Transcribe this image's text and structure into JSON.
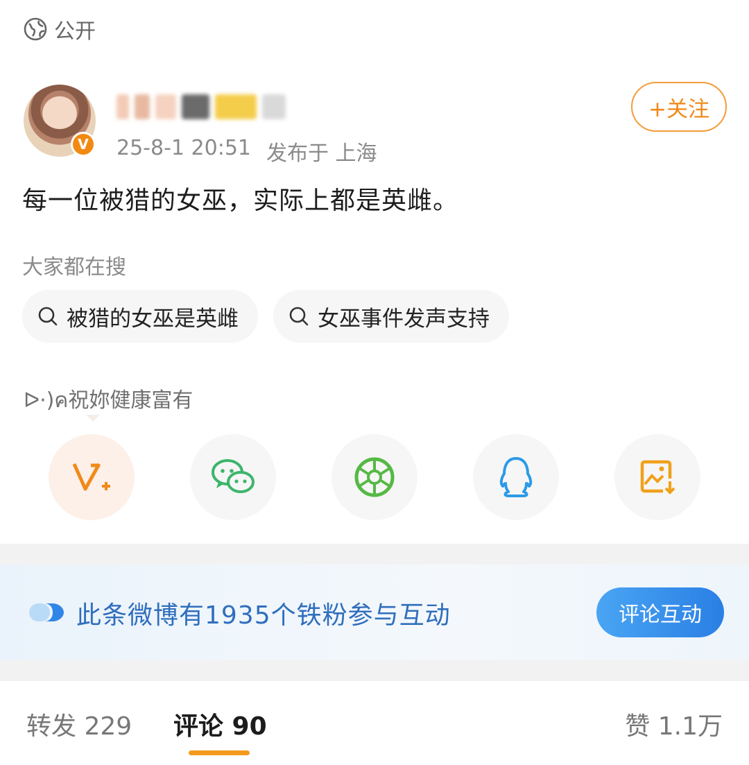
{
  "visibility": {
    "label": "公开",
    "icon": "globe-icon"
  },
  "author": {
    "avatar": "avatar",
    "verified_badge": "V",
    "time": "25-8-1 20:51",
    "location": "发布于 上海",
    "follow_label": "+关注"
  },
  "post": {
    "text": "每一位被猎的女巫，实际上都是英雌。"
  },
  "hot_search": {
    "title": "大家都在搜",
    "chips": [
      {
        "label": "被猎的女巫是英雌",
        "icon": "search-icon"
      },
      {
        "label": "女巫事件发声支持",
        "icon": "search-icon"
      }
    ]
  },
  "share": {
    "label": "ᐅ·)ค祝妳健康富有",
    "targets": [
      {
        "icon": "weibo-repost-icon",
        "color": "#f08a1a"
      },
      {
        "icon": "wechat-icon",
        "color": "#3cb56b"
      },
      {
        "icon": "moments-icon",
        "color": "#55b945"
      },
      {
        "icon": "qq-icon",
        "color": "#2b9ae8"
      },
      {
        "icon": "save-image-icon",
        "color": "#f0a01a"
      }
    ]
  },
  "fan_banner": {
    "text": "此条微博有1935个铁粉参与互动",
    "button": "评论互动"
  },
  "tabs": {
    "repost": "转发 229",
    "comment": "评论 90",
    "like": "赞 1.1万",
    "active": "comment",
    "accent": "#f39a1e"
  }
}
